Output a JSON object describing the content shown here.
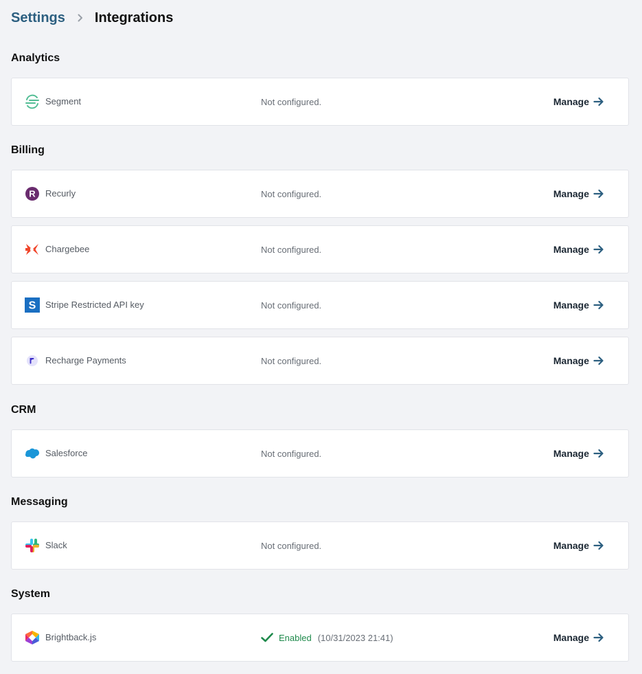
{
  "breadcrumb": {
    "parent": "Settings",
    "current": "Integrations"
  },
  "manage_label": "Manage",
  "sections": [
    {
      "title": "Analytics",
      "items": [
        {
          "name": "Segment",
          "icon": "segment-logo-icon",
          "status": "Not configured."
        }
      ]
    },
    {
      "title": "Billing",
      "items": [
        {
          "name": "Recurly",
          "icon": "recurly-logo-icon",
          "status": "Not configured."
        },
        {
          "name": "Chargebee",
          "icon": "chargebee-logo-icon",
          "status": "Not configured."
        },
        {
          "name": "Stripe Restricted API key",
          "icon": "stripe-logo-icon",
          "status": "Not configured."
        },
        {
          "name": "Recharge Payments",
          "icon": "recharge-logo-icon",
          "status": "Not configured."
        }
      ]
    },
    {
      "title": "CRM",
      "items": [
        {
          "name": "Salesforce",
          "icon": "salesforce-logo-icon",
          "status": "Not configured."
        }
      ]
    },
    {
      "title": "Messaging",
      "items": [
        {
          "name": "Slack",
          "icon": "slack-logo-icon",
          "status": "Not configured."
        }
      ]
    },
    {
      "title": "System",
      "items": [
        {
          "name": "Brightback.js",
          "icon": "brightback-logo-icon",
          "status": "Enabled",
          "timestamp": "(10/31/2023 21:41)"
        }
      ]
    }
  ],
  "colors": {
    "accent": "#2c5f80",
    "enabled": "#1f8a4c",
    "background": "#f2f3f6"
  }
}
